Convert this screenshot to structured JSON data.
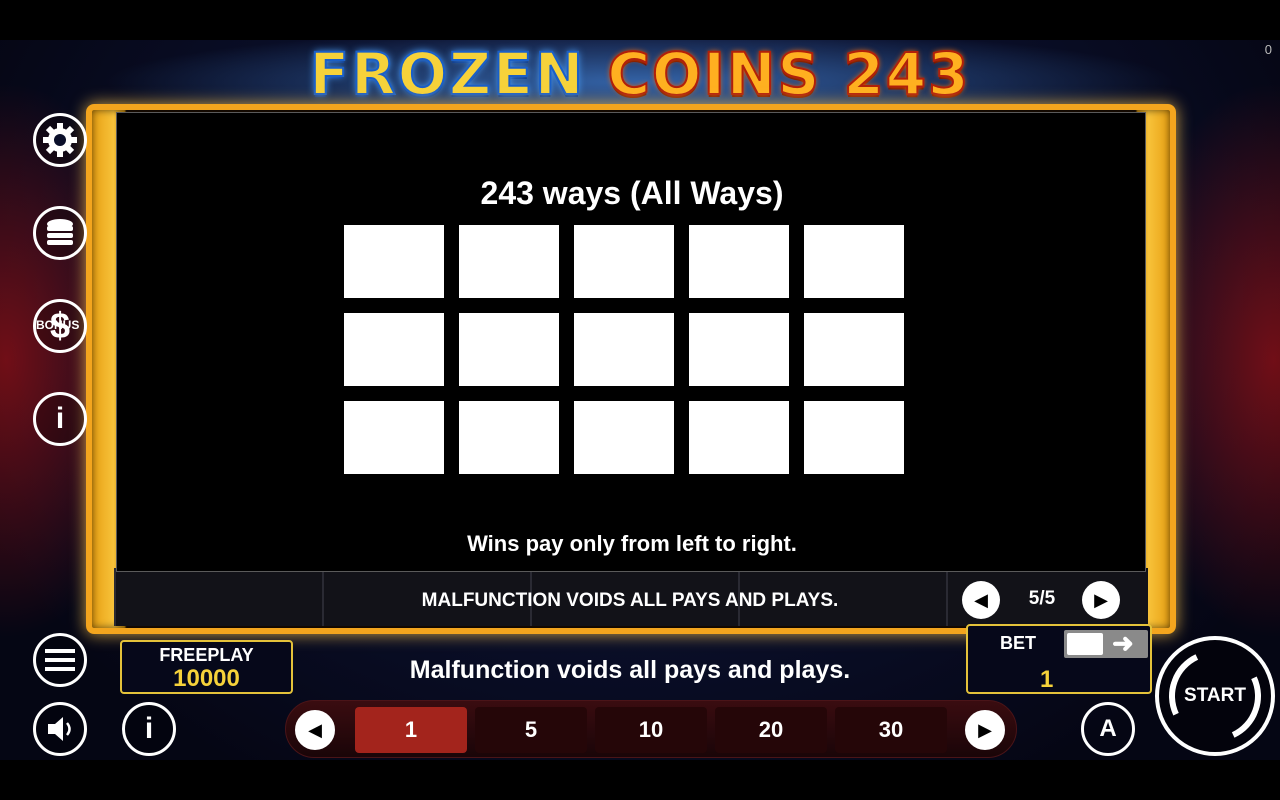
{
  "game": {
    "title_part1": "FROZEN",
    "title_part2": "COINS 243",
    "corner_counter": "0"
  },
  "sidebar": {
    "items": [
      {
        "name": "settings",
        "icon": "gear-icon"
      },
      {
        "name": "bet-coins",
        "icon": "coin-stack-icon"
      },
      {
        "name": "bonus",
        "icon": "dollar-icon",
        "label": "BONUS"
      },
      {
        "name": "info",
        "icon": "info-icon",
        "glyph": "i"
      }
    ],
    "menu_icon": "hamburger-menu-icon",
    "sound_icon": "speaker-icon",
    "info_glyph": "i"
  },
  "paytable": {
    "title": "243 ways (All Ways)",
    "rows": 3,
    "cols": 5,
    "note": "Wins pay only from left to right."
  },
  "reel_footer": {
    "malfunction": "MALFUNCTION VOIDS ALL PAYS AND PLAYS.",
    "page": "5/5"
  },
  "freeplay": {
    "label": "FREEPLAY",
    "value": "10000"
  },
  "message": "Malfunction voids all pays and plays.",
  "bet": {
    "label": "BET",
    "value": "1"
  },
  "bet_options": {
    "selected": "1",
    "values": [
      "1",
      "5",
      "10",
      "20",
      "30"
    ]
  },
  "controls": {
    "start_label": "START",
    "auto_label": "A"
  },
  "colors": {
    "frame_gold": "#f3a51e",
    "value_yellow": "#f6d23a",
    "selected_bet": "#a3241c"
  }
}
